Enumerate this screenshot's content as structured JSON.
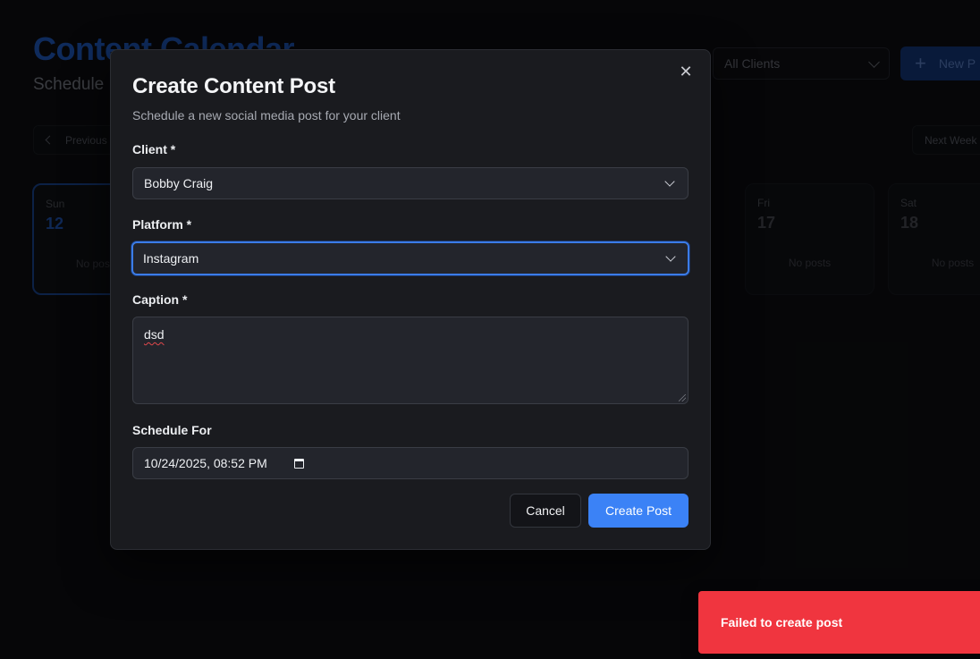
{
  "page": {
    "title": "Content Calendar",
    "subtitle": "Schedule",
    "client_filter": "All Clients",
    "new_button": "New P",
    "prev_button": "Previous",
    "next_button": "Next Week",
    "days": [
      {
        "name": "Sun",
        "num": "12",
        "empty": "No posts"
      },
      {
        "name": "Fri",
        "num": "17",
        "empty": "No posts"
      },
      {
        "name": "Sat",
        "num": "18",
        "empty": "No posts"
      }
    ]
  },
  "modal": {
    "title": "Create Content Post",
    "description": "Schedule a new social media post for your client",
    "close_glyph": "✕",
    "client": {
      "label": "Client *",
      "value": "Bobby Craig"
    },
    "platform": {
      "label": "Platform *",
      "value": "Instagram"
    },
    "caption": {
      "label": "Caption *",
      "value": "dsd"
    },
    "schedule": {
      "label": "Schedule For",
      "value": "10/24/2025, 08:52 PM"
    },
    "cancel_label": "Cancel",
    "create_label": "Create Post"
  },
  "toast": {
    "message": "Failed to create post"
  },
  "colors": {
    "accent": "#3b82f6",
    "error": "#f0353f",
    "modal_bg": "#1a1b1f"
  }
}
